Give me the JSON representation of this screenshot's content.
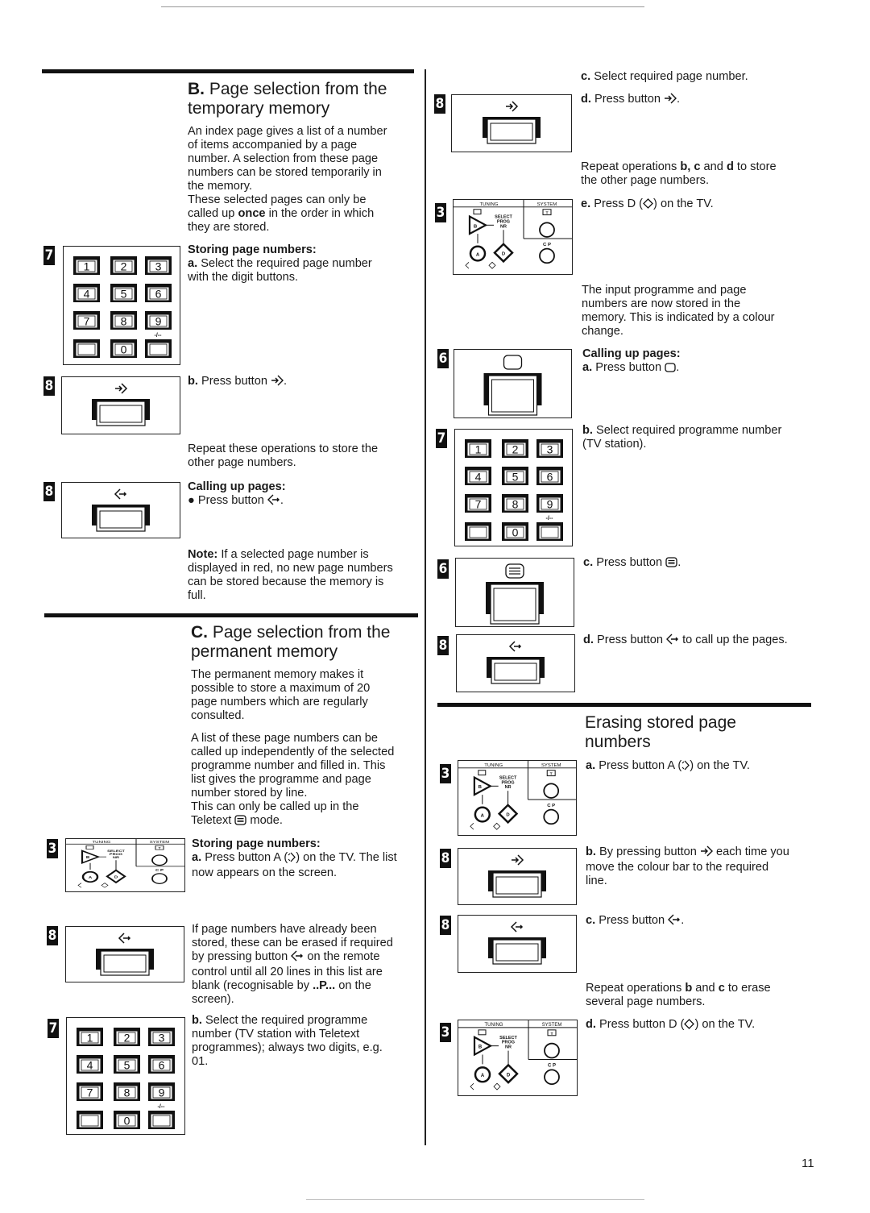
{
  "page_number": "11",
  "section_b": {
    "letter": "B.",
    "title": "Page selection from the temporary memory",
    "title_line1": "Page selection from the",
    "title_line2": "temporary memory",
    "intro": [
      "An index page gives a list of a number",
      "of items accompanied by a page",
      "number. A selection from these page",
      "numbers can be stored temporarily in",
      "the memory.",
      "These selected pages can only be"
    ],
    "intro_once_pre": "called up ",
    "intro_once_bold": "once",
    "intro_once_post": " in the order in which",
    "intro_last": "they are stored.",
    "storing_label": "Storing page numbers:",
    "step_a_letter": "a.",
    "step_a_text1": " Select the required page number",
    "step_a_text2": "with the digit buttons.",
    "step_b_letter": "b.",
    "step_b_text": " Press button ",
    "step_b_icon": "store-arrow-icon",
    "repeat_text1": "Repeat these operations to store the",
    "repeat_text2": "other page numbers.",
    "calling_label": "Calling up pages:",
    "calling_bullet": "●",
    "calling_text": " Press button ",
    "calling_icon": "recall-arrow-icon",
    "note_label": "Note:",
    "note_lines": [
      " If a selected page number is",
      "displayed in red, no new page numbers",
      "can be stored because the memory is",
      "full."
    ]
  },
  "section_c": {
    "letter": "C.",
    "title_line1": "Page selection from the",
    "title_line2": "permanent memory",
    "intro1": [
      "The permanent memory makes it",
      "possible to store a maximum of 20",
      "page numbers which are regularly",
      "consulted."
    ],
    "intro2": [
      "A list of these page numbers can be",
      "called up independently of the selected",
      "programme number and filled in. This",
      "list gives the programme and page",
      "number stored by line.",
      "This can only be called up in the"
    ],
    "intro2_last_pre": "Teletext ",
    "intro2_last_post": " mode.",
    "storing_label": "Storing page numbers:",
    "step_a_letter": "a.",
    "step_a_lines": [
      " Press button A (",
      ") on the TV. The list",
      "now appears on the screen."
    ],
    "erase_lines": [
      "If page numbers have already been",
      "stored, these can be erased if required",
      "by pressing button ",
      " on the remote",
      "control until all 20 lines in this list are",
      "blank (recognisable by ",
      "..P...",
      " on the",
      "screen)."
    ],
    "step_b_letter": "b.",
    "step_b_lines": [
      " Select the required programme",
      "number (TV station with Teletext",
      "programmes); always two digits, e.g.",
      "01."
    ],
    "step_c_letter": "c.",
    "step_c_text": " Select required page number.",
    "step_d_letter": "d.",
    "step_d_text": " Press button ",
    "repeat_pre": "Repeat operations ",
    "repeat_b": "b,",
    "repeat_c": " c",
    "repeat_and": " and ",
    "repeat_d": "d",
    "repeat_post": " to store",
    "repeat_line2": "the other page numbers.",
    "step_e_letter": "e.",
    "step_e_pre": " Press D (",
    "step_e_post": ") on the TV.",
    "stored_lines": [
      "The input programme and page",
      "numbers are now stored in the",
      "memory. This is indicated by a colour",
      "change."
    ],
    "calling_label": "Calling up pages:",
    "call_a_letter": "a.",
    "call_a_text": " Press button ",
    "call_b_letter": "b.",
    "call_b_lines": [
      " Select required programme number",
      "(TV station)."
    ],
    "call_c_letter": "c.",
    "call_c_text": " Press button ",
    "call_d_letter": "d.",
    "call_d_pre": " Press button ",
    "call_d_post": " to call up the pages."
  },
  "section_erase": {
    "title_line1": "Erasing stored page",
    "title_line2": "numbers",
    "a_letter": "a.",
    "a_pre": " Press button A (",
    "a_post": ") on the TV.",
    "b_letter": "b.",
    "b_pre": " By pressing button ",
    "b_post": " each time you",
    "b_line2": "move the colour bar to the required",
    "b_line3": "line.",
    "c_letter": "c.",
    "c_text": " Press button ",
    "repeat_pre": "Repeat operations ",
    "repeat_b": "b",
    "repeat_and": " and ",
    "repeat_c": "c",
    "repeat_post": " to erase",
    "repeat_line2": "several page numbers.",
    "d_letter": "d.",
    "d_pre": " Press button D (",
    "d_post": ") on the TV."
  },
  "figures": {
    "keypad_tag": "7",
    "button_tag": "8",
    "tv_tag": "3",
    "screen_tag": "6",
    "keypad_keys": [
      "1",
      "2",
      "3",
      "4",
      "5",
      "6",
      "7",
      "8",
      "9",
      "",
      "0",
      ""
    ],
    "keypad_extra_label": "-/--",
    "tv_panel": {
      "tuning": "TUNING",
      "system": "SYSTEM",
      "select": "SELECT",
      "prog": "PROG",
      "nr": "NR",
      "cp": "C P",
      "btn_b": "B",
      "btn_a": "A",
      "btn_d": "D",
      "btn_t": "T"
    }
  }
}
